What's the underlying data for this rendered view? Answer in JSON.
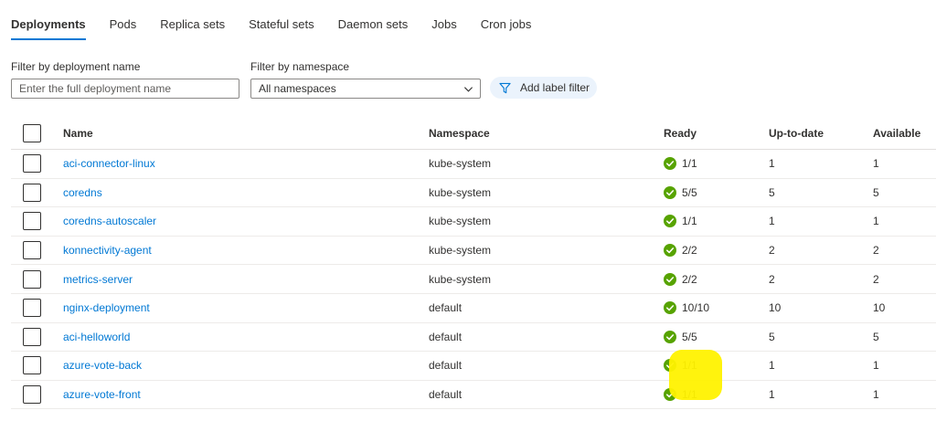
{
  "tabs": [
    {
      "label": "Deployments",
      "active": true
    },
    {
      "label": "Pods",
      "active": false
    },
    {
      "label": "Replica sets",
      "active": false
    },
    {
      "label": "Stateful sets",
      "active": false
    },
    {
      "label": "Daemon sets",
      "active": false
    },
    {
      "label": "Jobs",
      "active": false
    },
    {
      "label": "Cron jobs",
      "active": false
    }
  ],
  "filters": {
    "name_label": "Filter by deployment name",
    "name_placeholder": "Enter the full deployment name",
    "namespace_label": "Filter by namespace",
    "namespace_value": "All namespaces",
    "label_filter_button": "Add label filter"
  },
  "table": {
    "headers": {
      "name": "Name",
      "namespace": "Namespace",
      "ready": "Ready",
      "uptodate": "Up-to-date",
      "available": "Available"
    },
    "rows": [
      {
        "name": "aci-connector-linux",
        "namespace": "kube-system",
        "ready": "1/1",
        "uptodate": "1",
        "available": "1"
      },
      {
        "name": "coredns",
        "namespace": "kube-system",
        "ready": "5/5",
        "uptodate": "5",
        "available": "5"
      },
      {
        "name": "coredns-autoscaler",
        "namespace": "kube-system",
        "ready": "1/1",
        "uptodate": "1",
        "available": "1"
      },
      {
        "name": "konnectivity-agent",
        "namespace": "kube-system",
        "ready": "2/2",
        "uptodate": "2",
        "available": "2"
      },
      {
        "name": "metrics-server",
        "namespace": "kube-system",
        "ready": "2/2",
        "uptodate": "2",
        "available": "2"
      },
      {
        "name": "nginx-deployment",
        "namespace": "default",
        "ready": "10/10",
        "uptodate": "10",
        "available": "10"
      },
      {
        "name": "aci-helloworld",
        "namespace": "default",
        "ready": "5/5",
        "uptodate": "5",
        "available": "5"
      },
      {
        "name": "azure-vote-back",
        "namespace": "default",
        "ready": "1/1",
        "uptodate": "1",
        "available": "1"
      },
      {
        "name": "azure-vote-front",
        "namespace": "default",
        "ready": "1/1",
        "uptodate": "1",
        "available": "1"
      }
    ]
  },
  "colors": {
    "accent": "#0078d4",
    "success": "#57a300",
    "highlight": "#fff200"
  },
  "icons": {
    "status": "check-circle-icon",
    "filter": "funnel-icon",
    "dropdown": "chevron-down-icon"
  }
}
